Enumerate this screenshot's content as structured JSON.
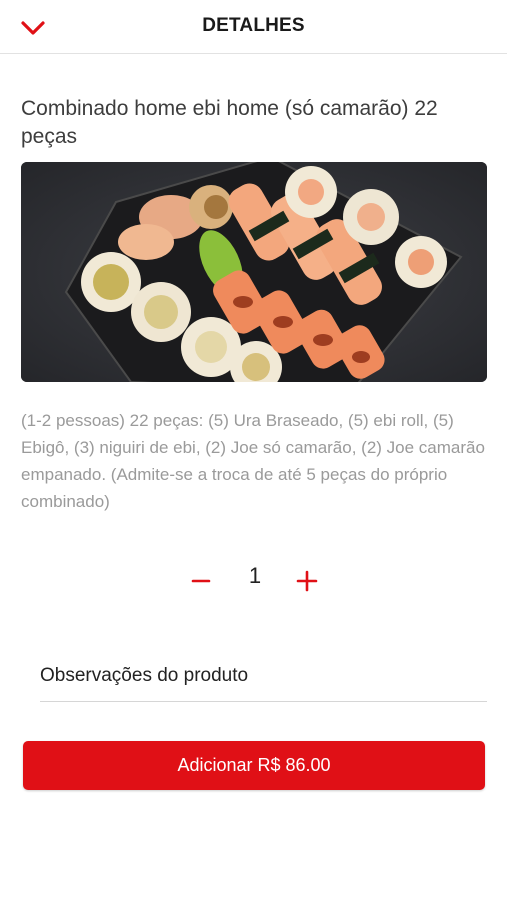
{
  "header": {
    "title": "DETALHES",
    "back_icon": "chevron-down-icon"
  },
  "product": {
    "title": "Combinado home ebi home (só camarão) 22 peças",
    "image_icon": "sushi-photo",
    "description": "(1-2 pessoas) 22 peças: (5) Ura Braseado, (5) ebi roll, (5) Ebigô, (3) niguiri de ebi, (2) Joe só camarão, (2) Joe camarão empanado. (Admite-se a troca de até 5 peças do próprio combinado)"
  },
  "quantity": {
    "value": "1",
    "minus_icon": "minus-icon",
    "plus_icon": "plus-icon"
  },
  "notes": {
    "placeholder": "Observações do produto"
  },
  "action": {
    "add_label": "Adicionar R$ 86.00"
  },
  "colors": {
    "accent": "#e01016",
    "description_text": "#9a9a9a"
  }
}
